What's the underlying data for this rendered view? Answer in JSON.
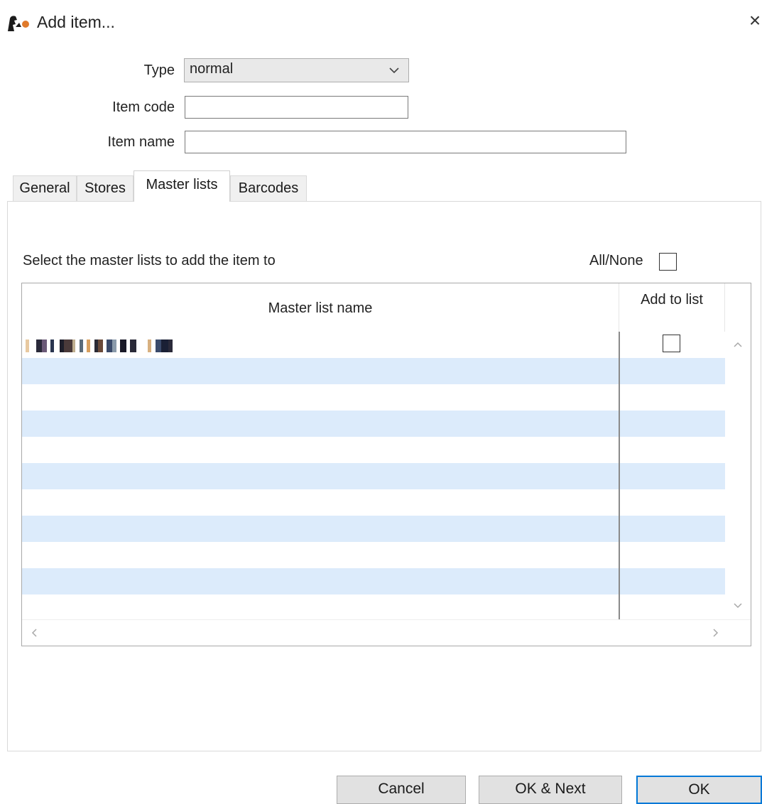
{
  "window": {
    "title": "Add item...",
    "close_glyph": "×",
    "icon": "app-logo-icon"
  },
  "form": {
    "type_label": "Type",
    "type_value": "normal",
    "code_label": "Item code",
    "code_value": "",
    "name_label": "Item name",
    "name_value": ""
  },
  "tabs": [
    {
      "label": "General",
      "selected": false
    },
    {
      "label": "Stores",
      "selected": false
    },
    {
      "label": "Master lists",
      "selected": true
    },
    {
      "label": "Barcodes",
      "selected": false
    }
  ],
  "master_lists": {
    "instructions": "Select the master lists to add the item to",
    "all_none_label": "All/None",
    "all_none_checked": false,
    "columns": {
      "name": "Master list name",
      "add": "Add to list"
    },
    "rows": [
      {
        "name_redacted": true,
        "checked": false
      }
    ],
    "stripe_color": "#dcebfb"
  },
  "buttons": {
    "cancel": "Cancel",
    "ok_next": "OK & Next",
    "ok": "OK"
  },
  "colors": {
    "ok_focus_border": "#0078d7",
    "button_bg": "#e1e1e1"
  }
}
